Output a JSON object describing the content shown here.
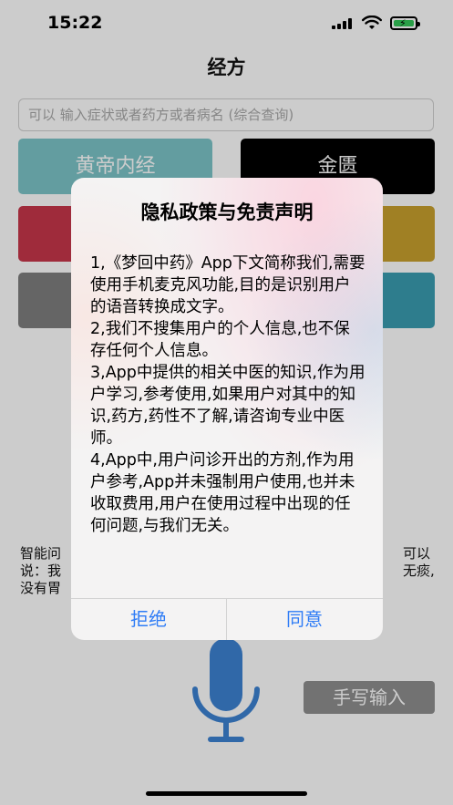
{
  "status_bar": {
    "time": "15:22"
  },
  "nav": {
    "title": "经方"
  },
  "search": {
    "placeholder": "可以 输入症状或者药方或者病名 (综合查询)"
  },
  "categories": [
    {
      "label": "黄帝内经",
      "color": "#7cc5c9"
    },
    {
      "label": "金匮",
      "color": "#000000"
    },
    {
      "label": "",
      "color": "#c7364a"
    },
    {
      "label": "",
      "color": "#c9a02e"
    },
    {
      "label": "",
      "color": "#7f7f7f"
    },
    {
      "label": "",
      "color": "#3a9db1"
    }
  ],
  "info": {
    "line1_left": "智能问",
    "line1_right": "可以",
    "line2_left": "说：我",
    "line2_right": "无痰,",
    "line3_left": "没有胃"
  },
  "handwrite_button": "手写输入",
  "dialog": {
    "title": "隐私政策与免责声明",
    "body": "1,《梦回中药》App下文简称我们,需要使用手机麦克风功能,目的是识别用户的语音转换成文字。\n2,我们不搜集用户的个人信息,也不保存任何个人信息。\n3,App中提供的相关中医的知识,作为用户学习,参考使用,如果用户对其中的知识,药方,药性不了解,请咨询专业中医师。\n4,App中,用户问诊开出的方剂,作为用户参考,App并未强制用户使用,也并未收取费用,用户在使用过程中出现的任何问题,与我们无关。",
    "reject": "拒绝",
    "agree": "同意"
  },
  "colors": {
    "accent": "#2e7cf6",
    "mic": "#3d82d3",
    "battery": "#34c759"
  }
}
